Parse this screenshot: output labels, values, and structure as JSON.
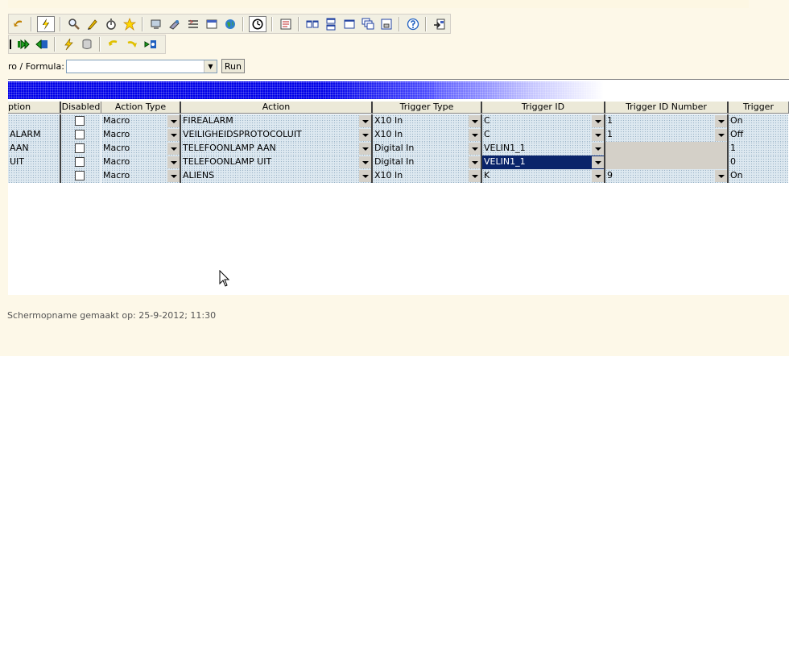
{
  "formula": {
    "label": "ro / Formula:",
    "value": "",
    "run_label": "Run"
  },
  "table": {
    "columns": [
      {
        "label": "ption",
        "width": 66
      },
      {
        "label": "Disabled",
        "width": 50
      },
      {
        "label": "Action Type",
        "width": 99
      },
      {
        "label": "Action",
        "width": 238
      },
      {
        "label": "Trigger Type",
        "width": 136
      },
      {
        "label": "Trigger ID",
        "width": 153
      },
      {
        "label": "Trigger ID Number",
        "width": 153
      },
      {
        "label": "Trigger",
        "width": 75
      }
    ],
    "rows": [
      {
        "description": "",
        "disabled": false,
        "action_type": "Macro",
        "action": "FIREALARM",
        "trigger_type": "X10 In",
        "trigger_id": "C",
        "trigger_id_number": "1",
        "trigger": "On"
      },
      {
        "description": "ALARM",
        "disabled": false,
        "action_type": "Macro",
        "action": "VEILIGHEIDSPROTOCOLUIT",
        "trigger_type": "X10 In",
        "trigger_id": "C",
        "trigger_id_number": "1",
        "trigger": "Off"
      },
      {
        "description": "AAN",
        "disabled": false,
        "action_type": "Macro",
        "action": "TELEFOONLAMP AAN",
        "trigger_type": "Digital In",
        "trigger_id": "VELIN1_1",
        "trigger_id_number": "",
        "trigger": "1"
      },
      {
        "description": "UIT",
        "disabled": false,
        "action_type": "Macro",
        "action": "TELEFOONLAMP UIT",
        "trigger_type": "Digital In",
        "trigger_id": "VELIN1_1",
        "trigger_id_number": "",
        "trigger": "0"
      },
      {
        "description": "",
        "disabled": false,
        "action_type": "Macro",
        "action": "ALIENS",
        "trigger_type": "X10 In",
        "trigger_id": "K",
        "trigger_id_number": "9",
        "trigger": "On"
      }
    ],
    "selected_cell": {
      "row": 3,
      "column": "trigger_id"
    }
  },
  "footer": {
    "text": "Schermopname gemaakt op: 25-9-2012; 11:30"
  },
  "colors": {
    "band_blue": "#0000e8",
    "selection": "#0a246a",
    "grid_dot": "#9cb4c8",
    "page_bg": "#fdf8e8"
  }
}
